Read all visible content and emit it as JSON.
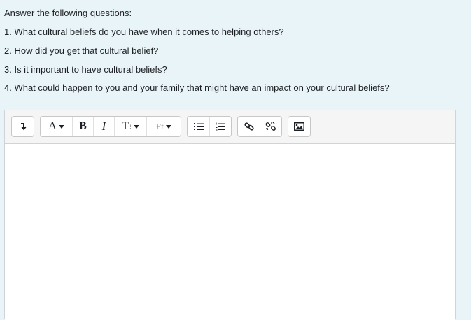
{
  "intro": "Answer the following questions:",
  "questions": [
    "1.  What cultural beliefs do you have when it comes to helping others?",
    "2. How did you get that cultural belief?",
    "3. Is it important to have cultural beliefs?",
    "4. What could happen to you and your family that might have an impact on your cultural beliefs?"
  ],
  "toolbar": {
    "font_color_label": "A",
    "bold_label": "B",
    "italic_label": "I",
    "text_style_label": "T",
    "font_family_label": "Ff",
    "icons": [
      "toolbar-toggle-icon",
      "font-color-icon",
      "bold-icon",
      "italic-icon",
      "text-style-icon",
      "font-family-icon",
      "unordered-list-icon",
      "ordered-list-icon",
      "link-icon",
      "unlink-icon",
      "image-icon"
    ]
  },
  "editor": {
    "content": ""
  }
}
